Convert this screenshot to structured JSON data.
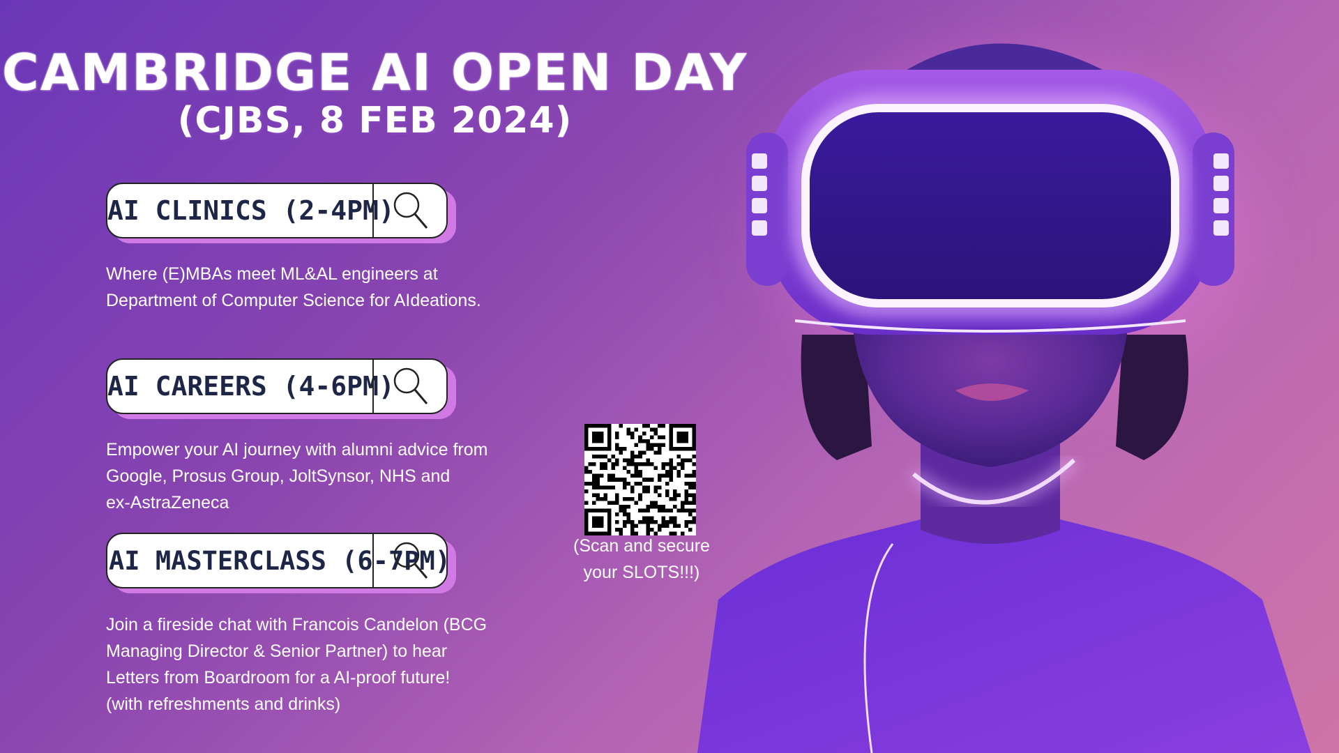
{
  "header": {
    "title": "CAMBRIDGE AI OPEN DAY",
    "subtitle": "(CJBS, 8 FEB 2024)"
  },
  "sessions": [
    {
      "label": "AI CLINICS (2-4PM)",
      "icon": "search-icon",
      "description_lines": [
        "Where (E)MBAs meet ML&AL engineers at",
        "Department of Computer Science for AIdeations."
      ]
    },
    {
      "label": "AI CAREERS (4-6PM)",
      "icon": "search-icon",
      "description_lines": [
        "Empower your AI journey with alumni advice from",
        "Google, Prosus Group, JoltSynsor, NHS and",
        "ex-AstraZeneca"
      ]
    },
    {
      "label": "AI MASTERCLASS (6-7PM)",
      "icon": "search-icon",
      "description_lines": [
        "Join a fireside chat with Francois Candelon (BCG",
        "Managing Director & Senior Partner) to hear",
        "Letters from Boardroom for a AI-proof future!",
        "(with refreshments and drinks)"
      ]
    }
  ],
  "qr": {
    "icon": "qr-code-icon",
    "caption_lines": [
      "(Scan and secure",
      "your SLOTS!!!)"
    ]
  },
  "colors": {
    "background_start": "#6a37b8",
    "background_end": "#cf74a8",
    "pill_text": "#1d2646",
    "pill_shadow": "#d17ae6",
    "headset_glow": "#f3e6ff"
  }
}
